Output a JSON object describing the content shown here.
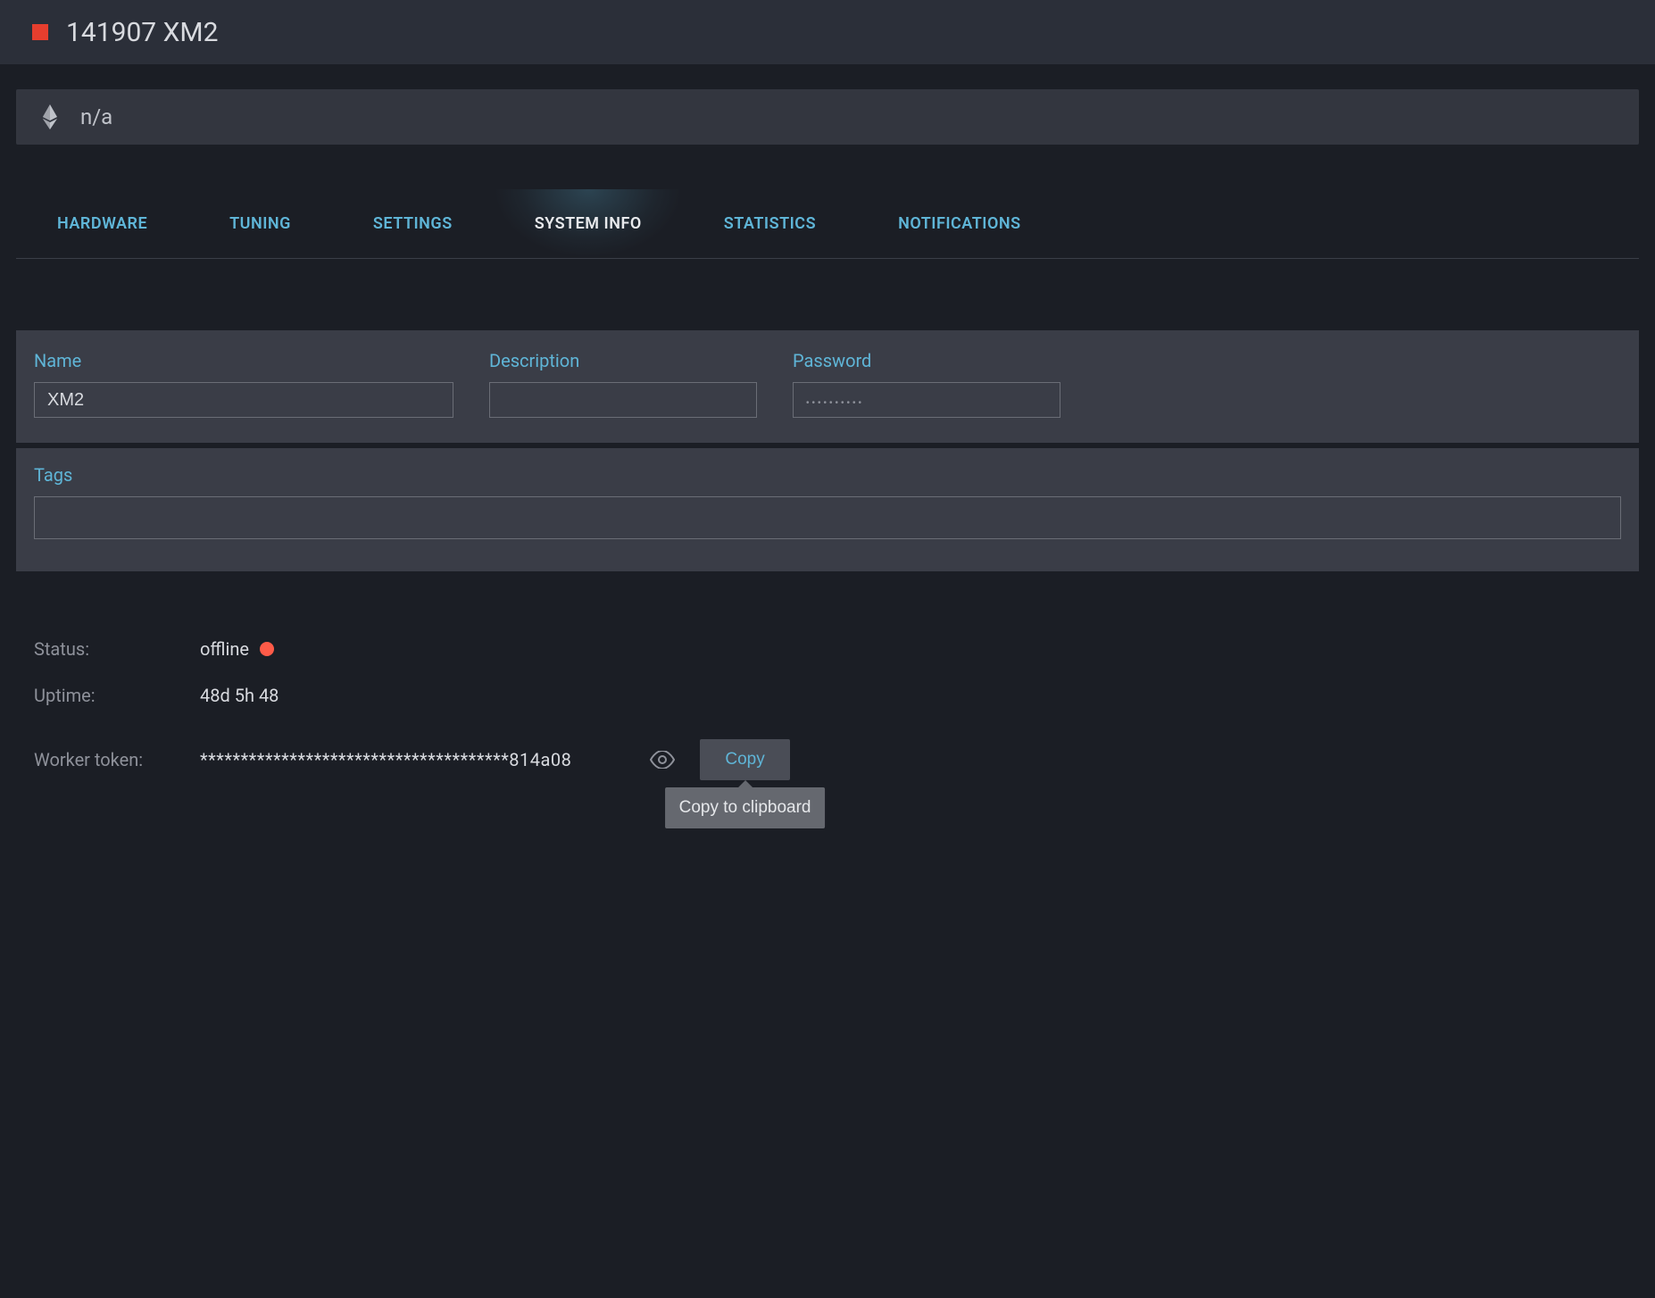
{
  "header": {
    "title": "141907 XM2"
  },
  "info_bar": {
    "text": "n/a"
  },
  "tabs": [
    {
      "id": "hardware",
      "label": "HARDWARE",
      "active": false
    },
    {
      "id": "tuning",
      "label": "TUNING",
      "active": false
    },
    {
      "id": "settings",
      "label": "SETTINGS",
      "active": false
    },
    {
      "id": "system-info",
      "label": "SYSTEM INFO",
      "active": true
    },
    {
      "id": "statistics",
      "label": "STATISTICS",
      "active": false
    },
    {
      "id": "notifications",
      "label": "NOTIFICATIONS",
      "active": false
    }
  ],
  "form": {
    "name": {
      "label": "Name",
      "value": "XM2"
    },
    "description": {
      "label": "Description",
      "value": ""
    },
    "password": {
      "label": "Password",
      "value": "••••••••••"
    },
    "tags": {
      "label": "Tags",
      "value": ""
    }
  },
  "details": {
    "status": {
      "label": "Status:",
      "value": "offline"
    },
    "uptime": {
      "label": "Uptime:",
      "value": "48d 5h 48"
    },
    "token": {
      "label": "Worker token:",
      "value": "**************************************814a08"
    }
  },
  "actions": {
    "copy": {
      "label": "Copy",
      "tooltip": "Copy to clipboard"
    }
  }
}
